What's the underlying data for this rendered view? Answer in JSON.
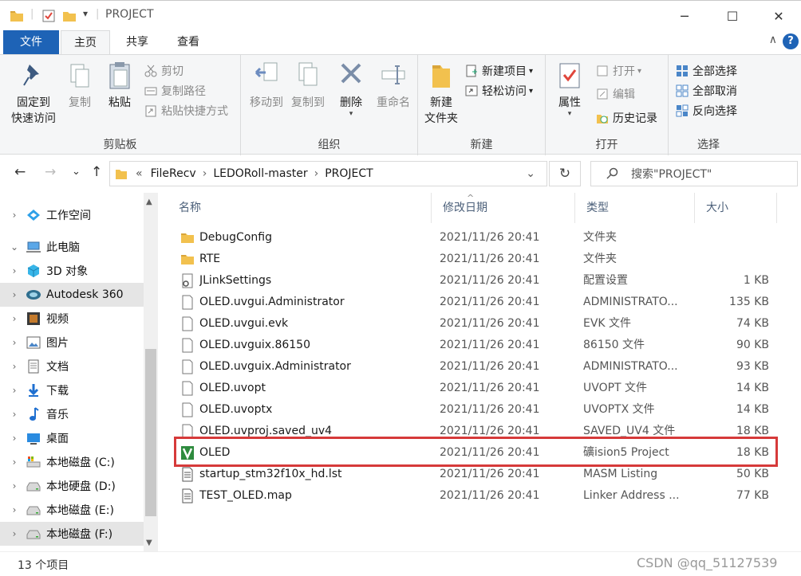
{
  "titlebar": {
    "title": "PROJECT",
    "separator": "|",
    "qat_dropdown": "▾",
    "minimize": "─",
    "maximize": "☐",
    "close": "✕"
  },
  "tabs": {
    "file": "文件",
    "home": "主页",
    "share": "共享",
    "view": "查看",
    "help": "?",
    "collapse": "∧"
  },
  "ribbon": {
    "clipboard": {
      "label": "剪贴板",
      "pin": "固定到\n快速访问",
      "pin_line1": "固定到",
      "pin_line2": "快速访问",
      "copy": "复制",
      "paste": "粘贴",
      "cut": "剪切",
      "copy_path": "复制路径",
      "paste_shortcut": "粘贴快捷方式"
    },
    "organize": {
      "label": "组织",
      "move_to": "移动到",
      "copy_to": "复制到",
      "delete": "删除",
      "rename": "重命名"
    },
    "new": {
      "label": "新建",
      "new_folder_line1": "新建",
      "new_folder_line2": "文件夹",
      "new_item": "新建项目",
      "easy_access": "轻松访问"
    },
    "open": {
      "label": "打开",
      "properties": "属性",
      "open": "打开",
      "edit": "编辑",
      "history": "历史记录"
    },
    "select": {
      "label": "选择",
      "select_all": "全部选择",
      "select_none": "全部取消",
      "invert": "反向选择"
    }
  },
  "address": {
    "back": "←",
    "forward": "→",
    "recent": "⌄",
    "up": "↑",
    "chevrons": "«",
    "crumbs": [
      "FileRecv",
      "LEDORoll-master",
      "PROJECT"
    ],
    "sep": "›",
    "dropdown": "⌄",
    "refresh": "↻",
    "search_placeholder": "搜索\"PROJECT\""
  },
  "nav": {
    "items": [
      {
        "label": "工作空间",
        "icon": "workspace-icon"
      },
      {
        "label": "此电脑",
        "icon": "pc-icon"
      },
      {
        "label": "3D 对象",
        "icon": "3d-objects-icon"
      },
      {
        "label": "Autodesk 360",
        "icon": "autodesk-icon"
      },
      {
        "label": "视频",
        "icon": "video-icon"
      },
      {
        "label": "图片",
        "icon": "pictures-icon"
      },
      {
        "label": "文档",
        "icon": "documents-icon"
      },
      {
        "label": "下载",
        "icon": "downloads-icon"
      },
      {
        "label": "音乐",
        "icon": "music-icon"
      },
      {
        "label": "桌面",
        "icon": "desktop-icon"
      },
      {
        "label": "本地磁盘 (C:)",
        "icon": "drive-c-icon"
      },
      {
        "label": "本地硬盘 (D:)",
        "icon": "drive-icon"
      },
      {
        "label": "本地磁盘 (E:)",
        "icon": "drive-icon"
      },
      {
        "label": "本地磁盘 (F:)",
        "icon": "drive-icon"
      }
    ],
    "chevron_right": "›",
    "chevron_down": "⌄",
    "scroll_up": "▲",
    "scroll_down": "▼"
  },
  "filelist": {
    "columns": {
      "name": "名称",
      "date": "修改日期",
      "type": "类型",
      "size": "大小"
    },
    "sort_indicator": "^",
    "rows": [
      {
        "name": "DebugConfig",
        "date": "2021/11/26 20:41",
        "type": "文件夹",
        "size": "",
        "icon": "folder-icon"
      },
      {
        "name": "RTE",
        "date": "2021/11/26 20:41",
        "type": "文件夹",
        "size": "",
        "icon": "folder-icon"
      },
      {
        "name": "JLinkSettings",
        "date": "2021/11/26 20:41",
        "type": "配置设置",
        "size": "1 KB",
        "icon": "settings-file-icon"
      },
      {
        "name": "OLED.uvgui.Administrator",
        "date": "2021/11/26 20:41",
        "type": "ADMINISTRATO...",
        "size": "135 KB",
        "icon": "file-icon"
      },
      {
        "name": "OLED.uvgui.evk",
        "date": "2021/11/26 20:41",
        "type": "EVK 文件",
        "size": "74 KB",
        "icon": "file-icon"
      },
      {
        "name": "OLED.uvguix.86150",
        "date": "2021/11/26 20:41",
        "type": "86150 文件",
        "size": "90 KB",
        "icon": "file-icon"
      },
      {
        "name": "OLED.uvguix.Administrator",
        "date": "2021/11/26 20:41",
        "type": "ADMINISTRATO...",
        "size": "93 KB",
        "icon": "file-icon"
      },
      {
        "name": "OLED.uvopt",
        "date": "2021/11/26 20:41",
        "type": "UVOPT 文件",
        "size": "14 KB",
        "icon": "file-icon"
      },
      {
        "name": "OLED.uvoptx",
        "date": "2021/11/26 20:41",
        "type": "UVOPTX 文件",
        "size": "14 KB",
        "icon": "file-icon"
      },
      {
        "name": "OLED.uvproj.saved_uv4",
        "date": "2021/11/26 20:41",
        "type": "SAVED_UV4 文件",
        "size": "18 KB",
        "icon": "file-icon"
      },
      {
        "name": "OLED",
        "date": "2021/11/26 20:41",
        "type": "礦ision5 Project",
        "size": "18 KB",
        "icon": "uvision-project-icon"
      },
      {
        "name": "startup_stm32f10x_hd.lst",
        "date": "2021/11/26 20:41",
        "type": "MASM Listing",
        "size": "50 KB",
        "icon": "listing-file-icon"
      },
      {
        "name": "TEST_OLED.map",
        "date": "2021/11/26 20:41",
        "type": "Linker Address ...",
        "size": "77 KB",
        "icon": "listing-file-icon"
      }
    ]
  },
  "status": {
    "item_count": "13 个项目",
    "watermark": "CSDN @qq_51127539"
  },
  "colors": {
    "accent": "#1e63b6",
    "highlight_box": "#d63a3a",
    "folder": "#f2c14e",
    "selected_nav": "#e5e5e5"
  }
}
